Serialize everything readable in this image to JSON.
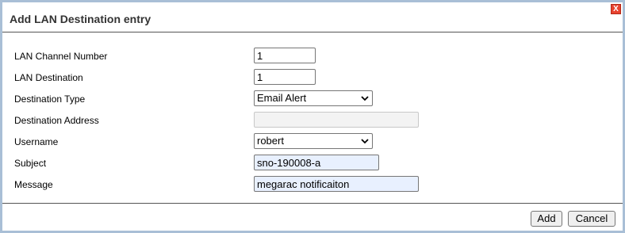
{
  "dialog": {
    "title": "Add LAN Destination entry",
    "close_label": "X"
  },
  "form": {
    "lan_channel_number": {
      "label": "LAN Channel Number",
      "value": "1"
    },
    "lan_destination": {
      "label": "LAN Destination",
      "value": "1"
    },
    "destination_type": {
      "label": "Destination Type",
      "value": "Email Alert"
    },
    "destination_address": {
      "label": "Destination Address",
      "value": ""
    },
    "username": {
      "label": "Username",
      "value": "robert"
    },
    "subject": {
      "label": "Subject",
      "value": "sno-190008-a"
    },
    "message": {
      "label": "Message",
      "value": "megarac notificaiton"
    }
  },
  "buttons": {
    "add_label": "Add",
    "cancel_label": "Cancel"
  },
  "icons": {
    "close": "close-icon",
    "dropdown": "chevron-down-icon"
  },
  "colors": {
    "border": "#a9bfd6",
    "close_bg": "#e8432f",
    "autofill_bg": "#e8f0fe"
  }
}
